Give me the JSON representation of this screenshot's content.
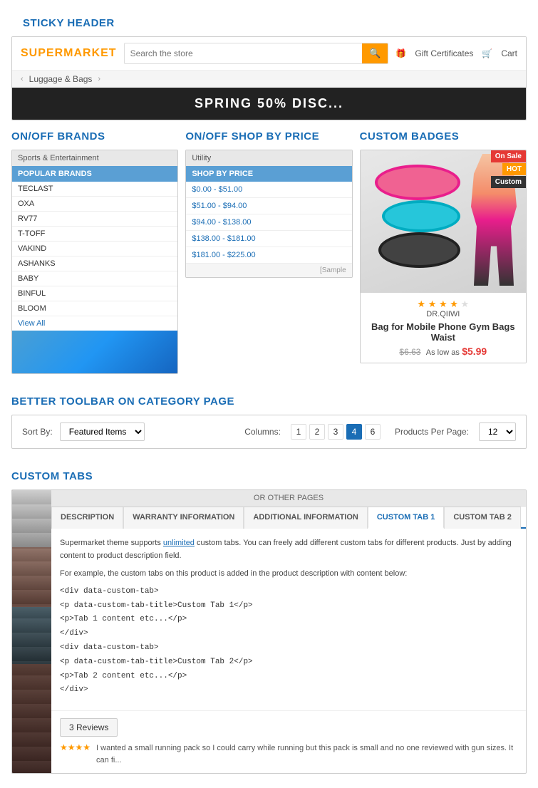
{
  "sections": {
    "sticky_header": {
      "title": "STICKY HEADER",
      "logo": "SUPERMARKET",
      "search_placeholder": "Search the store",
      "gift_certificates": "Gift Certificates",
      "cart": "Cart",
      "nav_item": "Luggage & Bags",
      "banner_text": "SPRING 50% DISC..."
    },
    "brands": {
      "title": "ON/OFF BRANDS",
      "header": "Sports & Entertainment",
      "popular_header": "POPULAR BRANDS",
      "items": [
        "TECLAST",
        "OXA",
        "RV77",
        "T-TOFF",
        "VAKIND",
        "ASHANKS",
        "BABY",
        "BINFUL",
        "BLOOM"
      ],
      "view_all": "View All"
    },
    "shop_by_price": {
      "title": "ON/OFF SHOP BY PRICE",
      "header": "Utility",
      "shop_header": "SHOP BY PRICE",
      "ranges": [
        "$0.00 - $51.00",
        "$51.00 - $94.00",
        "$94.00 - $138.00",
        "$138.00 - $181.00",
        "$181.00 - $225.00"
      ],
      "sample_text": "[Sample"
    },
    "custom_badges": {
      "title": "CUSTOM BADGES",
      "badge_on_sale": "On Sale",
      "badge_hot": "HOT",
      "badge_custom": "Custom",
      "brand_name": "DR.QIIWI",
      "product_name": "Bag for Mobile Phone Gym Bags Waist",
      "old_price": "$6.63",
      "as_low_as": "As low as",
      "new_price": "$5.99",
      "stars": 4,
      "max_stars": 5
    },
    "toolbar": {
      "title": "BETTER TOOLBAR ON CATEGORY PAGE",
      "sort_label": "Sort By:",
      "sort_value": "Featured Items",
      "columns_label": "Columns:",
      "column_options": [
        "1",
        "2",
        "3",
        "4",
        "6"
      ],
      "active_column": "4",
      "per_page_label": "Products Per Page:",
      "per_page_value": "12"
    },
    "custom_tabs": {
      "title": "CUSTOM TABS",
      "or_other": "OR OTHER PAGES",
      "tabs": [
        "DESCRIPTION",
        "WARRANTY INFORMATION",
        "ADDITIONAL INFORMATION",
        "CUSTOM TAB 1",
        "CUSTOM TAB 2"
      ],
      "active_tab": "CUSTOM TAB 1",
      "content_line1": "Supermarket theme supports unlimited custom tabs. You can freely add different custom tabs for different products. Just by adding content to product description field.",
      "content_line2": "For example, the custom tabs on this product is added in the product description with content below:",
      "code_block": "<div data-custom-tab>\n<p data-custom-tab-title>Custom Tab 1</p>\n<p>Tab 1 content etc...</p>\n</div>\n<div data-custom-tab>\n<p data-custom-tab-title>Custom Tab 2</p>\n<p>Tab 2 content etc...</p>\n</div>",
      "reviews_count": "3 Reviews",
      "review_stars": "★★★★",
      "review_text": "I wanted a small running pack so I could carry while running but this pack is small and no one reviewed with gun sizes. It can fi..."
    }
  }
}
